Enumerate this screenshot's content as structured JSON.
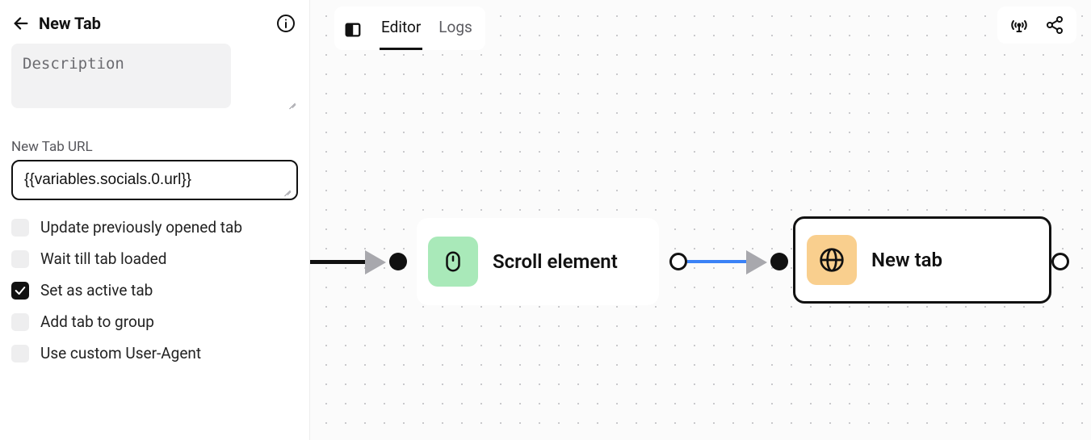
{
  "sidebar": {
    "title": "New Tab",
    "description_placeholder": "Description",
    "url_label": "New Tab URL",
    "url_value": "{{variables.socials.0.url}}",
    "checks": [
      {
        "label": "Update previously opened tab",
        "checked": false
      },
      {
        "label": "Wait till tab loaded",
        "checked": false
      },
      {
        "label": "Set as active tab",
        "checked": true
      },
      {
        "label": "Add tab to group",
        "checked": false
      },
      {
        "label": "Use custom User-Agent",
        "checked": false
      }
    ]
  },
  "toolbar": {
    "tabs": [
      {
        "label": "Editor",
        "active": true
      },
      {
        "label": "Logs",
        "active": false
      }
    ]
  },
  "nodes": {
    "scroll": {
      "label": "Scroll element"
    },
    "newtab": {
      "label": "New tab"
    }
  }
}
